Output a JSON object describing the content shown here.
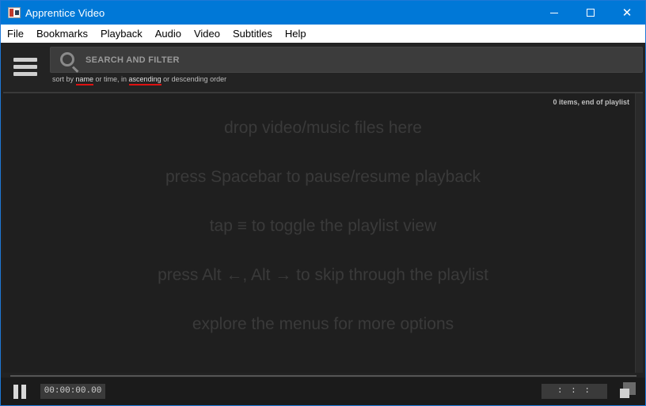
{
  "window": {
    "title": "Apprentice Video"
  },
  "menu": [
    "File",
    "Bookmarks",
    "Playback",
    "Audio",
    "Video",
    "Subtitles",
    "Help"
  ],
  "search": {
    "placeholder": "SEARCH AND FILTER",
    "value": ""
  },
  "sort_hint": {
    "prefix": "sort by ",
    "name_link": "name",
    "middle": " or time, in ",
    "ascending_link": "ascending",
    "suffix": " or descending order"
  },
  "playlist": {
    "status": "0 items, end of playlist",
    "hints": [
      "drop video/music files here",
      "press Spacebar to pause/resume playback",
      "tap ≡ to toggle the playlist view",
      "press Alt ←, Alt → to skip through the playlist",
      "explore the menus for more options"
    ]
  },
  "player": {
    "progress": 0,
    "current_time": "00:00:00.00",
    "duration": ": : :"
  },
  "colors": {
    "titlebar": "#0078d7",
    "accent_underline": "#dd1111"
  },
  "icons": [
    "app-icon",
    "minimize-icon",
    "maximize-icon",
    "close-icon",
    "hamburger-menu-icon",
    "search-icon",
    "pause-icon",
    "resize-icon"
  ]
}
